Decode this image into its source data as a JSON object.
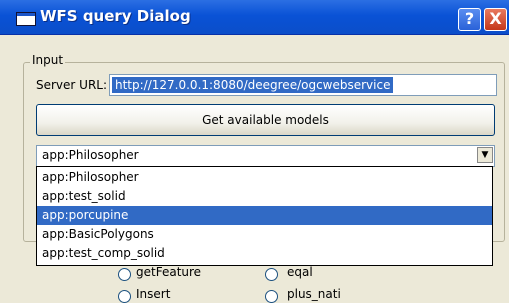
{
  "window": {
    "title": "WFS query Dialog",
    "help_label": "?",
    "close_label": "X"
  },
  "input_group": {
    "legend": "Input",
    "server_url_label": "Server URL:",
    "server_url_value": "http://127.0.0.1:8080/deegree/ogcwebservice",
    "get_models_label": "Get available models",
    "model_select": {
      "selected": "app:Philosopher",
      "options": [
        "app:Philosopher",
        "app:test_solid",
        "app:porcupine",
        "app:BasicPolygons",
        "app:test_comp_solid"
      ],
      "highlighted": "app:porcupine"
    }
  },
  "operations": {
    "get_feature": "getFeature",
    "insert": "Insert",
    "equal": "eqal",
    "plus": "plus_nati"
  },
  "colors": {
    "titlebar": "#0a52d6",
    "selection": "#316ac5",
    "face": "#ece9d8"
  }
}
